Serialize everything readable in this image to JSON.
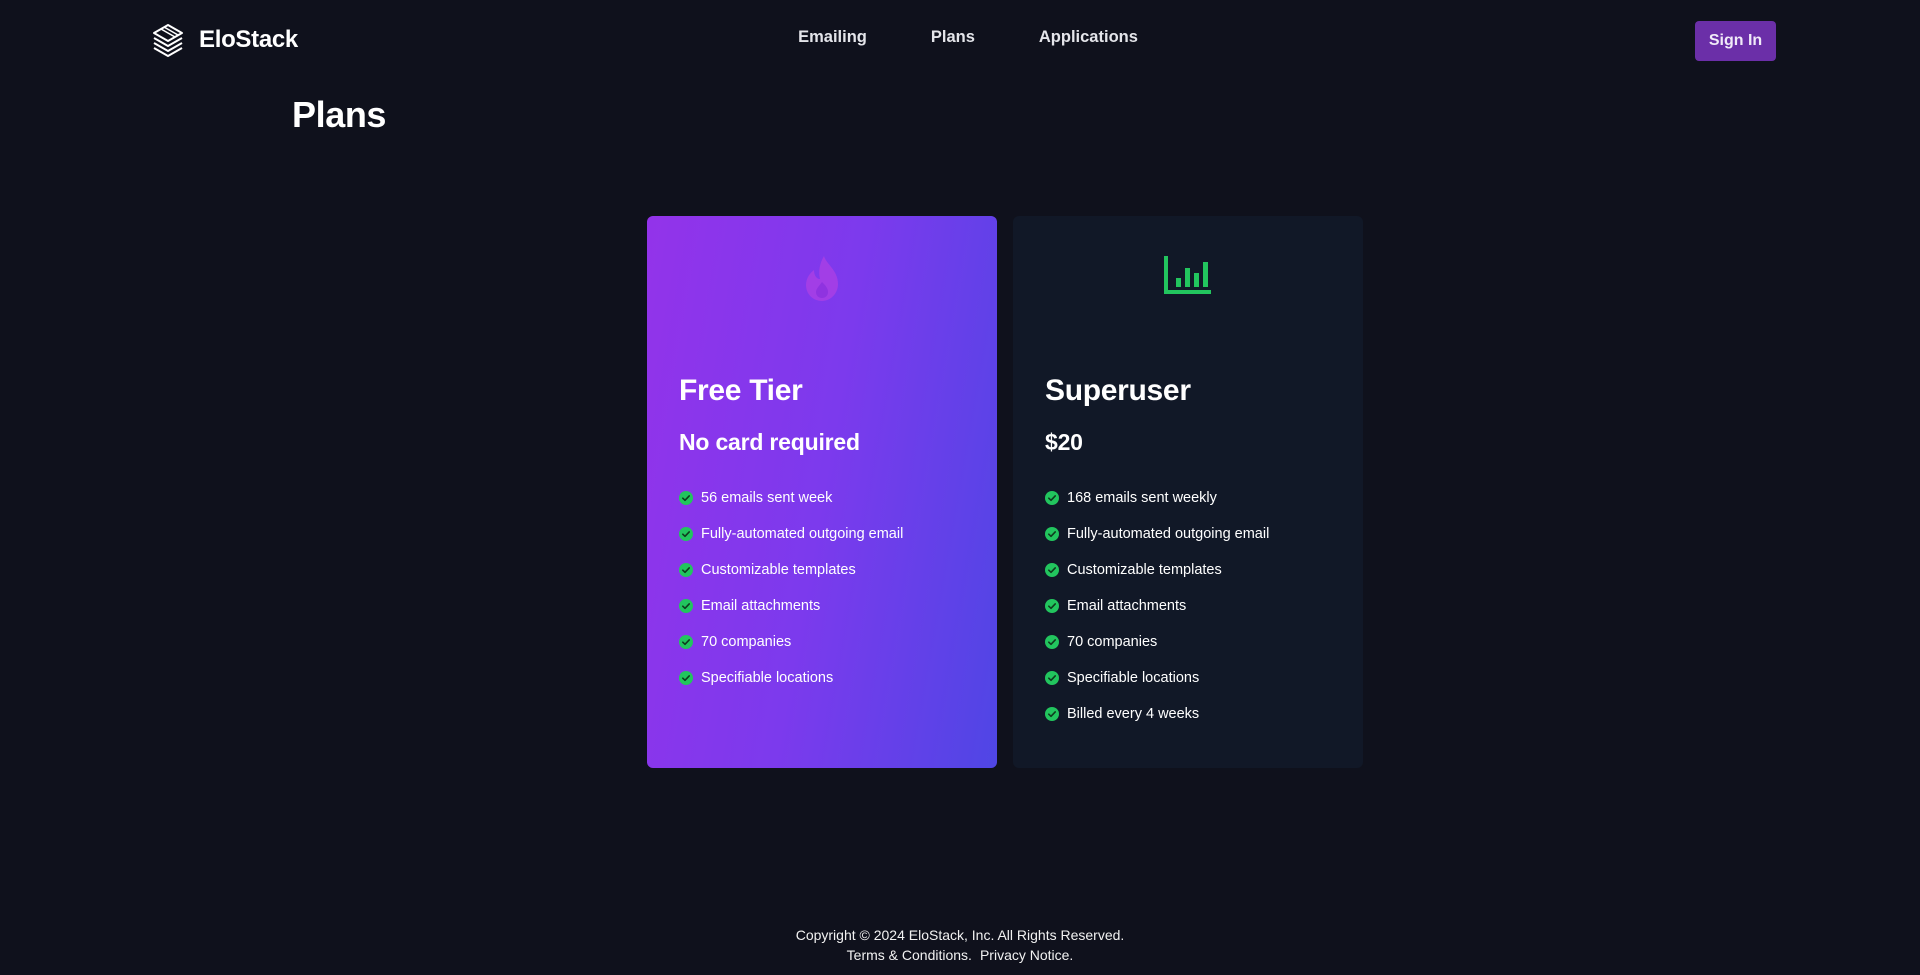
{
  "header": {
    "brand_name": "EloStack",
    "nav": [
      "Emailing",
      "Plans",
      "Applications"
    ],
    "signin_label": "Sign In"
  },
  "page_title": "Plans",
  "plans": [
    {
      "icon": "flame-icon",
      "title": "Free Tier",
      "subtitle": "No card required",
      "features": [
        "56 emails sent week",
        "Fully-automated outgoing email",
        "Customizable templates",
        "Email attachments",
        "70 companies",
        "Specifiable locations"
      ]
    },
    {
      "icon": "bar-chart-icon",
      "title": "Superuser",
      "subtitle": "$20",
      "features": [
        "168 emails sent weekly",
        "Fully-automated outgoing email",
        "Customizable templates",
        "Email attachments",
        "70 companies",
        "Specifiable locations",
        "Billed every 4 weeks"
      ]
    }
  ],
  "footer": {
    "copyright": "Copyright © 2024 EloStack, Inc. All Rights Reserved.",
    "terms": "Terms & Conditions.",
    "privacy": "Privacy Notice."
  },
  "colors": {
    "background": "#0f111c",
    "accent": "#6b2fa8",
    "check": "#22c55e",
    "card_dark": "#111827",
    "gradient_start": "#9333ea",
    "gradient_end": "#4f46e5"
  }
}
